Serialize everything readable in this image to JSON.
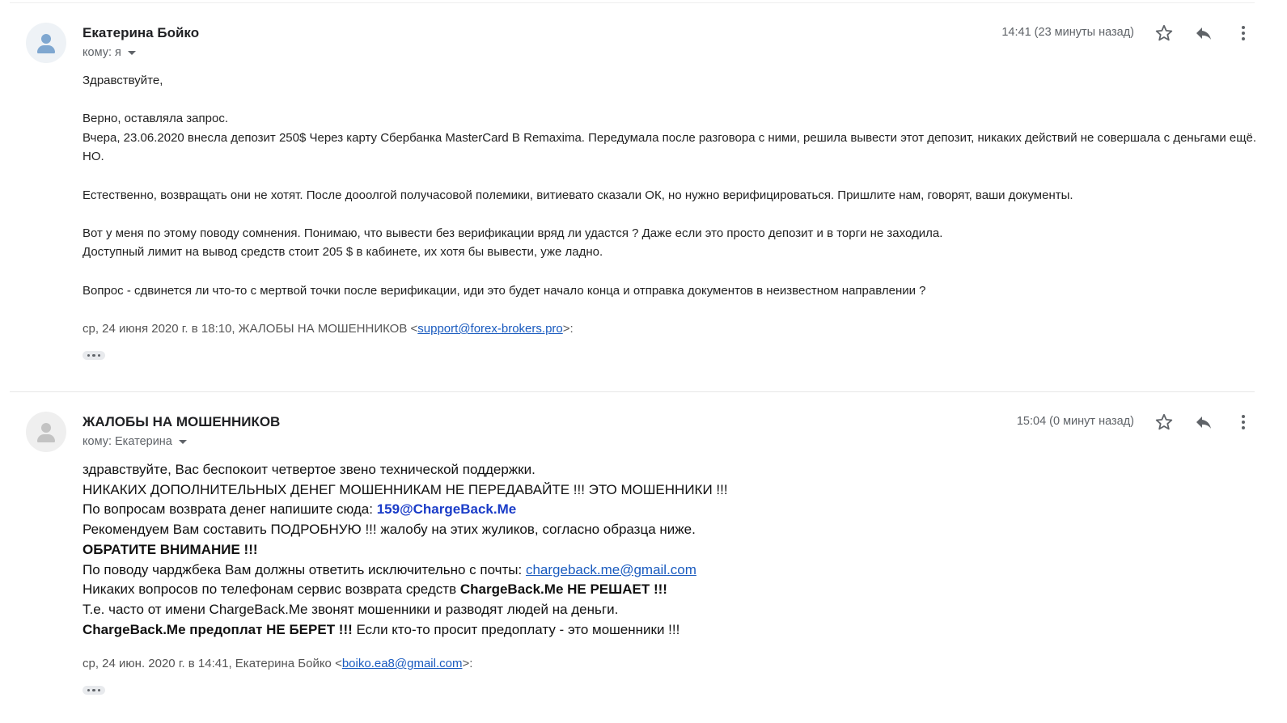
{
  "messages": [
    {
      "sender": "Екатерина Бойко",
      "recipient": "кому: я",
      "time": "14:41 (23 минуты назад)",
      "body": {
        "greeting": "Здравствуйте,",
        "p1_l1": "Верно, оставляла запрос.",
        "p1_l2": "Вчера, 23.06.2020 внесла депозит 250$ Через карту Сбербанка MasterCard  В Remaxima. Передумала после разговора с ними, решила вывести этот депозит, никаких действий не совершала с деньгами ещё. НО.",
        "p2": "Естественно, возвращать они не хотят. После дооолгой получасовой полемики, витиевато сказали ОК, но нужно верифицироваться. Пришлите нам, говорят, ваши документы.",
        "p3_l1": "Вот у меня по этому поводу сомнения. Понимаю, что вывести без верификации вряд ли удастся ? Даже если это просто депозит и в торги не заходила.",
        "p3_l2": "Доступный лимит на вывод средств стоит 205 $ в кабинете, их хотя бы вывести, уже ладно.",
        "p4": "Вопрос - сдвинется ли что-то с мертвой точки после верификации, иди это будет начало конца и отправка документов в неизвестном направлении ?"
      },
      "quote": {
        "prefix": "ср, 24 июня 2020 г. в 18:10, ЖАЛОБЫ НА МОШЕННИКОВ <",
        "email": "support@forex-brokers.pro",
        "suffix": ">:"
      }
    },
    {
      "sender": "ЖАЛОБЫ НА МОШЕННИКОВ",
      "recipient": "кому: Екатерина",
      "time": "15:04 (0 минут назад)",
      "body": {
        "l1": "здравствуйте, Вас беспокоит четвертое звено технической поддержки.",
        "l2": "НИКАКИХ ДОПОЛНИТЕЛЬНЫХ ДЕНЕГ МОШЕННИКАМ НЕ ПЕРЕДАВАЙТЕ !!! ЭТО МОШЕННИКИ !!!",
        "l3_prefix": "По вопросам возврата денег напишите сюда: ",
        "l3_email": "159@ChargeBack.Me",
        "l4": "Рекомендуем Вам составить ПОДРОБНУЮ !!! жалобу на этих жуликов, согласно образца ниже.",
        "l5": "ОБРАТИТЕ ВНИМАНИЕ !!!",
        "l6_prefix": "По поводу чарджбека Вам должны ответить исключительно с почты: ",
        "l6_email": "chargeback.me@gmail.com",
        "l7_prefix": "Никаких вопросов по телефонам сервис возврата средств ",
        "l7_bold": "ChargeBack.Me НЕ РЕШАЕТ !!!",
        "l8": "Т.е. часто от имени ChargeBack.Me звонят мошенники и разводят людей на деньги.",
        "l9_bold": "ChargeBack.Me предоплат НЕ БЕРЕТ !!!",
        "l9_suffix": " Если кто-то просит предоплату - это мошенники !!!"
      },
      "quote": {
        "prefix": "ср, 24 июн. 2020 г. в 14:41, Екатерина Бойко <",
        "email": "boiko.ea8@gmail.com",
        "suffix": ">:"
      }
    }
  ],
  "icons": {
    "star": "star-icon",
    "reply": "reply-icon",
    "more": "more-vert-icon",
    "avatar": "person-icon",
    "ellipsis": "show-trimmed-content-icon"
  },
  "colors": {
    "link": "#1a5bbf",
    "blue_bold": "#1a3cc8",
    "meta_gray": "#5f6368"
  }
}
